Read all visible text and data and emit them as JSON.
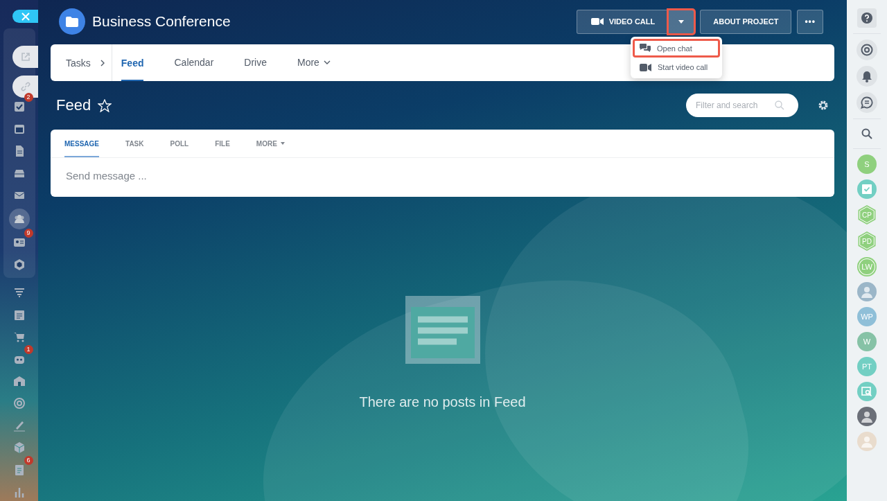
{
  "header": {
    "title": "Business Conference",
    "buttons": [
      {
        "kind": "video",
        "label": "VIDEO CALL"
      },
      {
        "kind": "caret",
        "highlighted": true
      },
      {
        "kind": "text",
        "label": "ABOUT PROJECT"
      },
      {
        "kind": "dots",
        "label": "•••"
      }
    ]
  },
  "dropdown": {
    "items": [
      {
        "kind": "chat",
        "label": "Open chat",
        "highlighted": true
      },
      {
        "kind": "video",
        "label": "Start video call",
        "highlighted": false
      }
    ]
  },
  "nav": {
    "breadcrumb": "Tasks",
    "tabs": [
      {
        "label": "Feed",
        "selected": true,
        "caret": false
      },
      {
        "label": "Calendar",
        "selected": false,
        "caret": false
      },
      {
        "label": "Drive",
        "selected": false,
        "caret": false
      },
      {
        "label": "More",
        "selected": false,
        "caret": true
      }
    ]
  },
  "page": {
    "title": "Feed",
    "search": {
      "placeholder": "Filter and search"
    }
  },
  "composer": {
    "tabs": [
      {
        "label": "MESSAGE",
        "selected": true,
        "caret": false
      },
      {
        "label": "TASK",
        "selected": false,
        "caret": false
      },
      {
        "label": "POLL",
        "selected": false,
        "caret": false
      },
      {
        "label": "FILE",
        "selected": false,
        "caret": false
      },
      {
        "label": "MORE",
        "selected": false,
        "caret": true
      }
    ],
    "placeholder": "Send message ..."
  },
  "empty": {
    "text": "There are no posts in Feed"
  },
  "left_sidebar": {
    "shortcuts": [
      {
        "kind": "external"
      },
      {
        "kind": "link"
      }
    ],
    "items": [
      {
        "kind": "check",
        "badge": "2",
        "selected": false
      },
      {
        "kind": "calendar",
        "selected": false
      },
      {
        "kind": "doc",
        "selected": false
      },
      {
        "kind": "drawer",
        "selected": false
      },
      {
        "kind": "mail",
        "selected": false
      },
      {
        "kind": "people",
        "selected": true
      },
      {
        "kind": "card",
        "badge": "9",
        "selected": false
      },
      {
        "kind": "hexagon",
        "selected": false
      }
    ],
    "more_items": [
      {
        "kind": "funnel"
      },
      {
        "kind": "list"
      },
      {
        "kind": "cart"
      },
      {
        "kind": "robot",
        "badge": "1"
      },
      {
        "kind": "house"
      },
      {
        "kind": "target"
      },
      {
        "kind": "pen"
      },
      {
        "kind": "cube"
      },
      {
        "kind": "clipboard",
        "badge": "6"
      },
      {
        "kind": "chart"
      }
    ]
  },
  "right_sidebar": {
    "tools": [
      {
        "kind": "help"
      },
      {
        "kind": "at"
      },
      {
        "kind": "bell"
      },
      {
        "kind": "chat"
      },
      {
        "kind": "search"
      }
    ],
    "contacts": [
      {
        "kind": "circle",
        "initials": "S",
        "color": "#8fd07e"
      },
      {
        "kind": "task",
        "color": "#72cfc3"
      },
      {
        "kind": "hexagon",
        "initials": "CP",
        "color": "#8fd07e"
      },
      {
        "kind": "hexagon",
        "initials": "PD",
        "color": "#8fd07e"
      },
      {
        "kind": "ring",
        "initials": "LW",
        "color": "#8fd07e"
      },
      {
        "kind": "photo",
        "color": "#9bb6c8"
      },
      {
        "kind": "circle",
        "initials": "WP",
        "color": "#8fbfd8"
      },
      {
        "kind": "circle",
        "initials": "W",
        "color": "#86c2a6"
      },
      {
        "kind": "circle",
        "initials": "PT",
        "color": "#72cfc3"
      },
      {
        "kind": "searchdoc",
        "color": "#72cfc3"
      },
      {
        "kind": "photo",
        "color": "#6b6f78"
      },
      {
        "kind": "photo",
        "color": "#e9dccd"
      }
    ]
  }
}
